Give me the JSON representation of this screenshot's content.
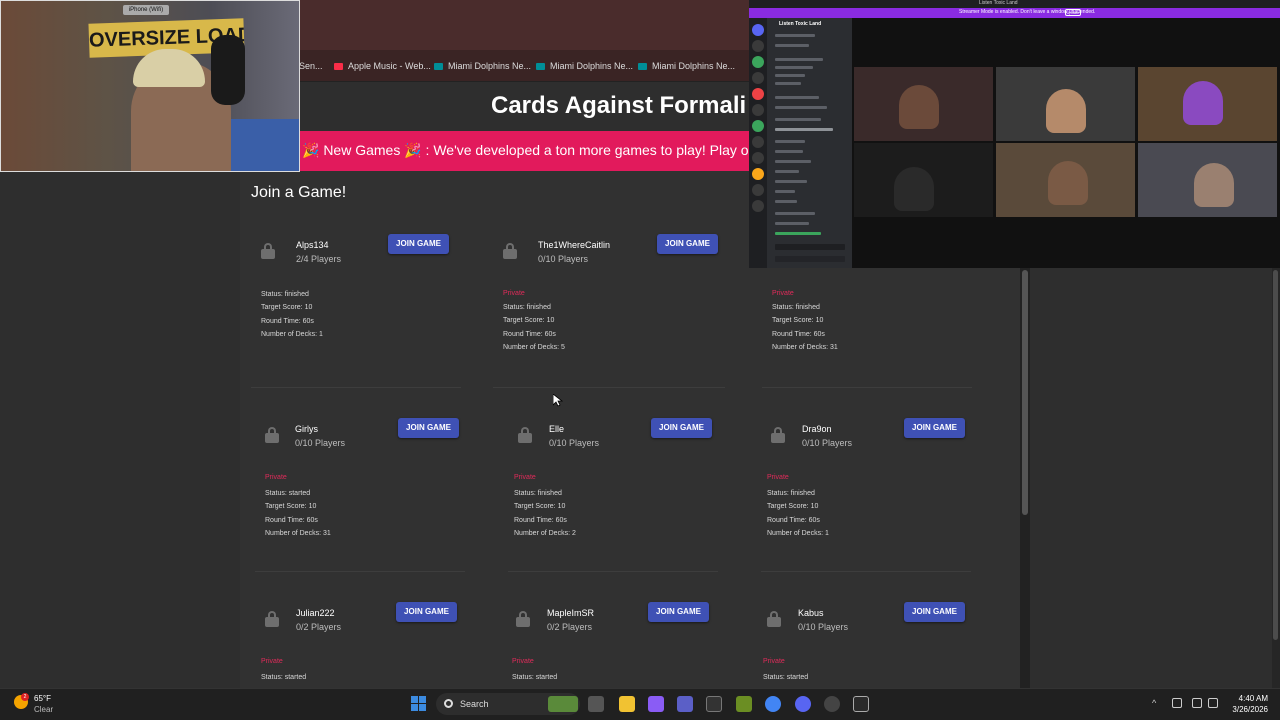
{
  "bookmarks": [
    {
      "label": "Sen...",
      "color": "#555555"
    },
    {
      "label": "Apple Music - Web...",
      "color": "#fa2d48"
    },
    {
      "label": "Miami Dolphins Ne...",
      "color": "#008e97"
    },
    {
      "label": "Miami Dolphins Ne...",
      "color": "#008e97"
    },
    {
      "label": "Miami Dolphins Ne...",
      "color": "#008e97"
    }
  ],
  "site": {
    "title": "Cards Against Formali",
    "banner": "🎉 New Games 🎉 :  We've developed a ton more games to play! Play o",
    "join_heading": "Join a Game!",
    "accent": "#e21a5c",
    "button_color": "#3f51b5"
  },
  "games": [
    {
      "name": "Alps134",
      "players": "2/4 Players",
      "join": "JOIN GAME",
      "privacy": "",
      "status": "Status: finished",
      "target": "Target Score: 10",
      "round": "Round Time: 60s",
      "decks": "Number of Decks: 1"
    },
    {
      "name": "The1WhereCaitlin",
      "players": "0/10 Players",
      "join": "JOIN GAME",
      "privacy": "Private",
      "status": "Status: finished",
      "target": "Target Score: 10",
      "round": "Round Time: 60s",
      "decks": "Number of Decks: 5"
    },
    {
      "name": "",
      "players": "",
      "join": "",
      "privacy": "Private",
      "status": "Status: finished",
      "target": "Target Score: 10",
      "round": "Round Time: 60s",
      "decks": "Number of Decks: 31"
    },
    {
      "name": "Girlys",
      "players": "0/10 Players",
      "join": "JOIN GAME",
      "privacy": "Private",
      "status": "Status: started",
      "target": "Target Score: 10",
      "round": "Round Time: 60s",
      "decks": "Number of Decks: 31"
    },
    {
      "name": "Elle",
      "players": "0/10 Players",
      "join": "JOIN GAME",
      "privacy": "Private",
      "status": "Status: finished",
      "target": "Target Score: 10",
      "round": "Round Time: 60s",
      "decks": "Number of Decks: 2"
    },
    {
      "name": "Dra9on",
      "players": "0/10 Players",
      "join": "JOIN GAME",
      "privacy": "Private",
      "status": "Status: finished",
      "target": "Target Score: 10",
      "round": "Round Time: 60s",
      "decks": "Number of Decks: 1"
    },
    {
      "name": "Julian222",
      "players": "0/2 Players",
      "join": "JOIN GAME",
      "privacy": "Private",
      "status": "Status: started",
      "target": "",
      "round": "",
      "decks": ""
    },
    {
      "name": "MapleImSR",
      "players": "0/2 Players",
      "join": "JOIN GAME",
      "privacy": "Private",
      "status": "Status: started",
      "target": "",
      "round": "",
      "decks": ""
    },
    {
      "name": "Kabus",
      "players": "0/10 Players",
      "join": "JOIN GAME",
      "privacy": "Private",
      "status": "Status: started",
      "target": "",
      "round": "",
      "decks": ""
    }
  ],
  "webcam": {
    "label": "iPhone (Wifi)",
    "sign": "OVERSIZE LOAD"
  },
  "discord": {
    "title": "Listen Toxic Land",
    "notice": "Streamer Mode is enabled. Don't leave a window unattended.",
    "notice_button": "Update",
    "server_name": "Listen Toxic Land"
  },
  "taskbar": {
    "temp": "65°F",
    "condition": "Clear",
    "weather_badge": "2",
    "search": "Search",
    "time": "4:40 AM",
    "date": "3/26/2026"
  }
}
